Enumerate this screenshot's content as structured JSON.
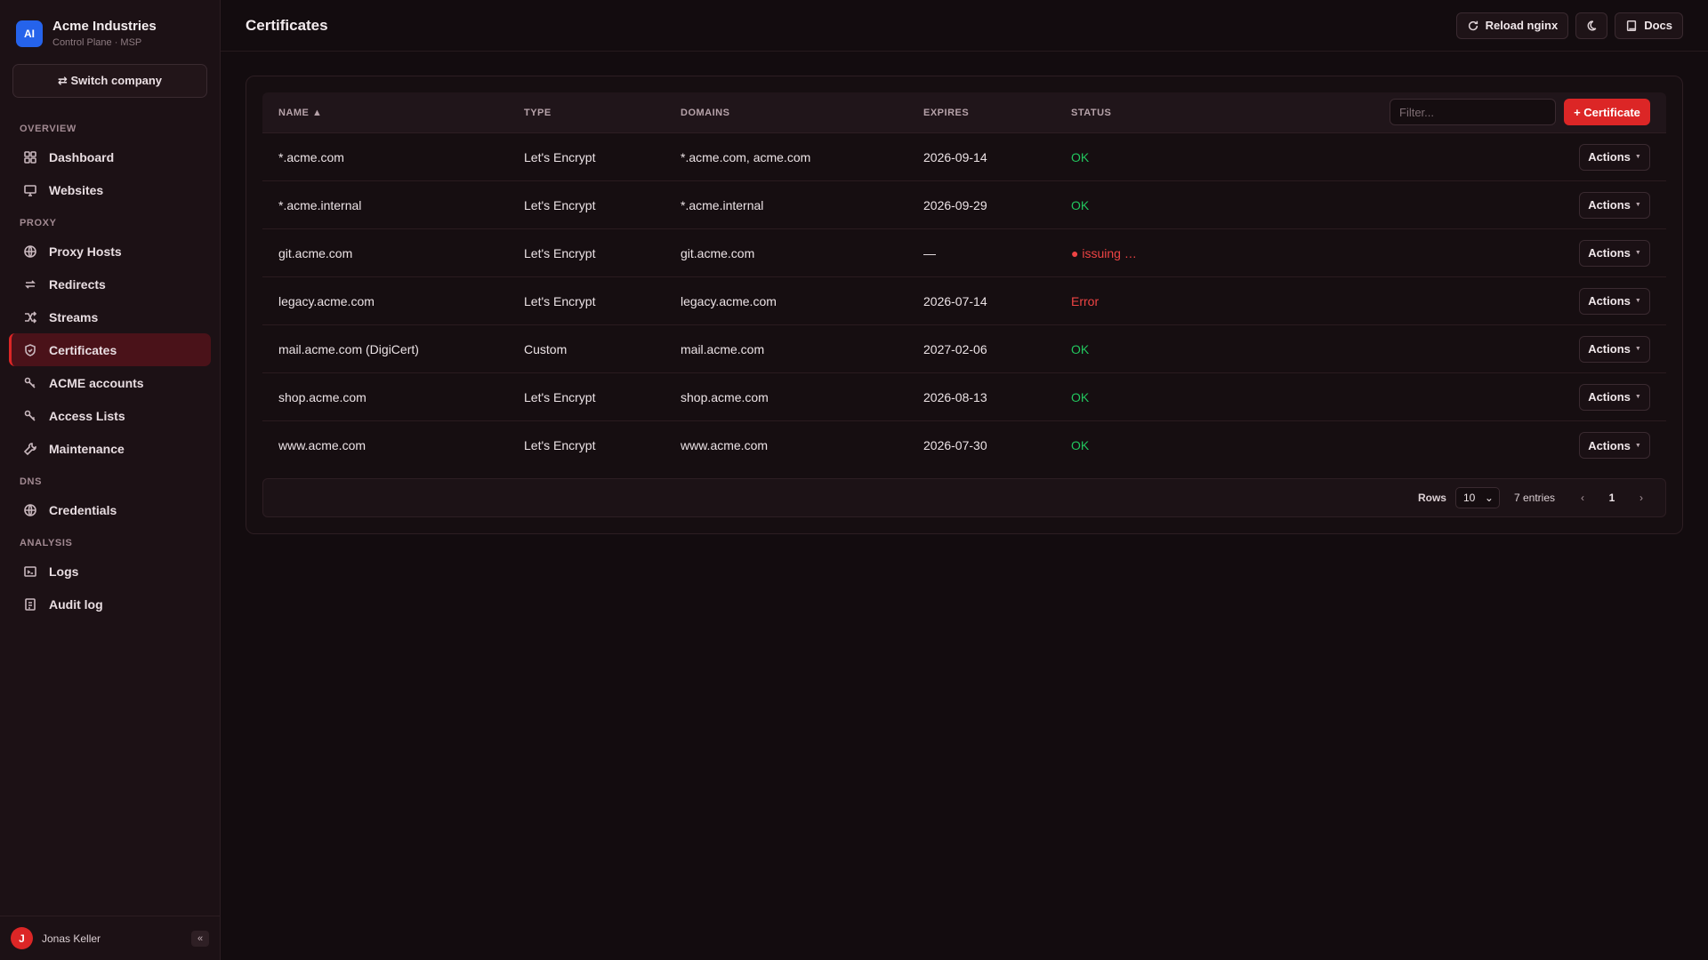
{
  "brand": {
    "logo": "AI",
    "name": "Acme Industries",
    "subtitle": "Control Plane · MSP"
  },
  "sidebar": {
    "switch_label": "⇄ Switch company",
    "sections": [
      {
        "title": "OVERVIEW",
        "items": [
          {
            "label": "Dashboard",
            "icon": "dashboard-icon"
          },
          {
            "label": "Websites",
            "icon": "monitor-icon"
          }
        ]
      },
      {
        "title": "PROXY",
        "items": [
          {
            "label": "Proxy Hosts",
            "icon": "globe-icon"
          },
          {
            "label": "Redirects",
            "icon": "redirect-icon"
          },
          {
            "label": "Streams",
            "icon": "shuffle-icon"
          },
          {
            "label": "Certificates",
            "icon": "shield-icon",
            "active": true
          },
          {
            "label": "ACME accounts",
            "icon": "key-icon"
          },
          {
            "label": "Access Lists",
            "icon": "key-icon"
          },
          {
            "label": "Maintenance",
            "icon": "wrench-icon"
          }
        ]
      },
      {
        "title": "DNS",
        "items": [
          {
            "label": "Credentials",
            "icon": "globe-icon"
          }
        ]
      },
      {
        "title": "ANALYSIS",
        "items": [
          {
            "label": "Logs",
            "icon": "terminal-icon"
          },
          {
            "label": "Audit log",
            "icon": "clipboard-icon"
          }
        ]
      }
    ],
    "user": {
      "initial": "J",
      "name": "Jonas Keller"
    },
    "collapse_label": "«"
  },
  "header": {
    "title": "Certificates",
    "reload_label": "Reload nginx",
    "theme_icon": "moon-icon",
    "docs_label": "Docs"
  },
  "table": {
    "columns": {
      "name": "NAME ▲",
      "type": "TYPE",
      "domains": "DOMAINS",
      "expires": "EXPIRES",
      "status": "STATUS"
    },
    "filter_placeholder": "Filter...",
    "add_label": "+ Certificate",
    "actions_label": "Actions",
    "rows": [
      {
        "name": "*.acme.com",
        "type": "Let's Encrypt",
        "domains": "*.acme.com, acme.com",
        "expires": "2026-09-14",
        "status": "OK",
        "status_kind": "ok"
      },
      {
        "name": "*.acme.internal",
        "type": "Let's Encrypt",
        "domains": "*.acme.internal",
        "expires": "2026-09-29",
        "status": "OK",
        "status_kind": "ok"
      },
      {
        "name": "git.acme.com",
        "type": "Let's Encrypt",
        "domains": "git.acme.com",
        "expires": "—",
        "status": "● issuing …",
        "status_kind": "issuing"
      },
      {
        "name": "legacy.acme.com",
        "type": "Let's Encrypt",
        "domains": "legacy.acme.com",
        "expires": "2026-07-14",
        "status": "Error",
        "status_kind": "err"
      },
      {
        "name": "mail.acme.com (DigiCert)",
        "type": "Custom",
        "domains": "mail.acme.com",
        "expires": "2027-02-06",
        "status": "OK",
        "status_kind": "ok"
      },
      {
        "name": "shop.acme.com",
        "type": "Let's Encrypt",
        "domains": "shop.acme.com",
        "expires": "2026-08-13",
        "status": "OK",
        "status_kind": "ok"
      },
      {
        "name": "www.acme.com",
        "type": "Let's Encrypt",
        "domains": "www.acme.com",
        "expires": "2026-07-30",
        "status": "OK",
        "status_kind": "ok"
      }
    ]
  },
  "pagination": {
    "rows_label": "Rows",
    "rows_value": "10",
    "entries": "7 entries",
    "prev": "‹",
    "page": "1",
    "next": "›"
  },
  "colors": {
    "accent": "#dc2626",
    "ok": "#22c55e",
    "error": "#ef4444",
    "brand_logo": "#2563eb"
  }
}
